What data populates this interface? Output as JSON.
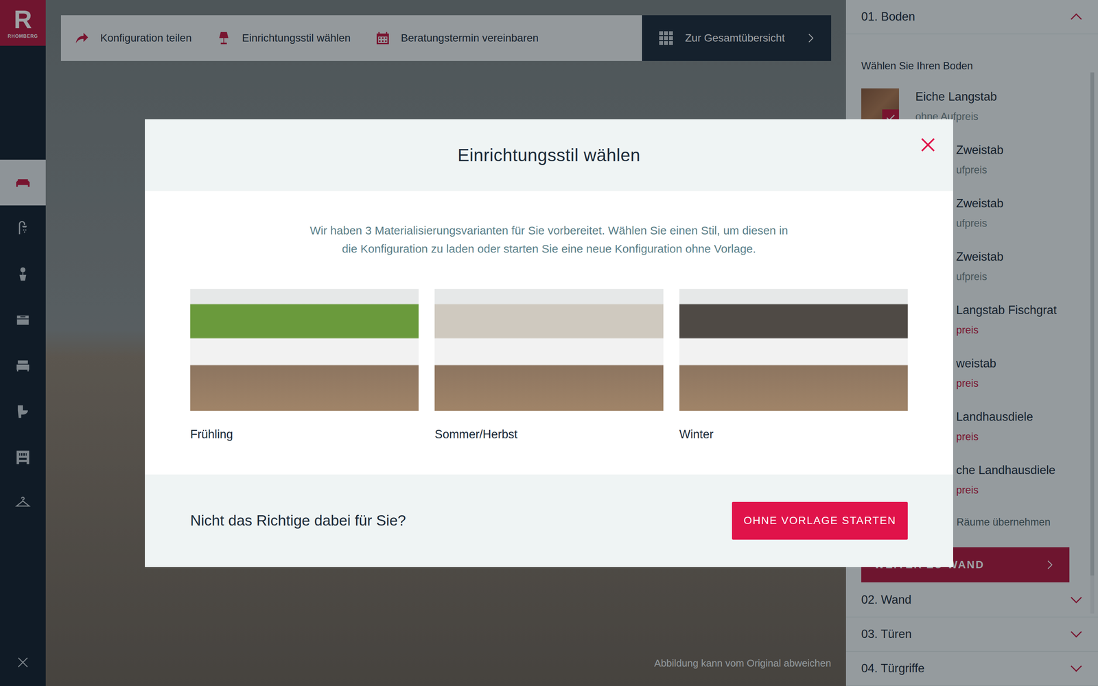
{
  "logo": {
    "letter": "R",
    "name": "RHOMBERG"
  },
  "nav": [
    {
      "selected": true
    },
    {
      "selected": false
    },
    {
      "selected": false
    },
    {
      "selected": false
    },
    {
      "selected": false
    },
    {
      "selected": false
    },
    {
      "selected": false
    },
    {
      "selected": false
    }
  ],
  "toolbar": {
    "actions": [
      {
        "label": "Konfiguration teilen"
      },
      {
        "label": "Einrichtungsstil wählen"
      },
      {
        "label": "Beratungstermin vereinbaren"
      }
    ],
    "overview": "Zur Gesamtübersicht"
  },
  "caption": "Abbildung kann vom Original abweichen",
  "panel": {
    "sections": [
      {
        "title": "01. Boden",
        "expanded": true
      },
      {
        "title": "02. Wand",
        "expanded": false
      },
      {
        "title": "03. Türen",
        "expanded": false
      },
      {
        "title": "04. Türgriffe",
        "expanded": false
      }
    ],
    "prompt": "Wählen Sie Ihren Boden",
    "options": [
      {
        "title": "Eiche Langstab",
        "price": "ohne Aufpreis",
        "surcharge": false,
        "selected": true
      },
      {
        "title": "Zweistab",
        "price": "ufpreis",
        "surcharge": false,
        "selected": false
      },
      {
        "title": "Zweistab",
        "price": "ufpreis",
        "surcharge": false,
        "selected": false
      },
      {
        "title": "Zweistab",
        "price": "ufpreis",
        "surcharge": false,
        "selected": false
      },
      {
        "title": "Langstab Fischgrat",
        "price": "preis",
        "surcharge": true,
        "selected": false
      },
      {
        "title": "weistab",
        "price": "preis",
        "surcharge": true,
        "selected": false
      },
      {
        "title": "Landhausdiele",
        "price": "preis",
        "surcharge": true,
        "selected": false
      },
      {
        "title": "che Landhausdiele",
        "price": "preis",
        "surcharge": true,
        "selected": false
      }
    ],
    "apply_all": "Räume übernehmen",
    "next_button": "WEITER ZU WAND"
  },
  "modal": {
    "title": "Einrichtungsstil wählen",
    "intro": [
      "Wir haben 3 Materialisierungsvarianten für Sie vorbereitet. Wählen Sie einen Stil, um diesen in",
      "die Konfiguration zu laden oder starten Sie eine neue Konfiguration ohne Vorlage."
    ],
    "styles": [
      {
        "label": "Frühling",
        "color": "#6a9a3c"
      },
      {
        "label": "Sommer/Herbst",
        "color": "#cfc9bf"
      },
      {
        "label": "Winter",
        "color": "#4f4a45"
      }
    ],
    "footer_text": "Nicht das Richtige dabei für Sie?",
    "button": "OHNE VORLAGE STARTEN"
  }
}
